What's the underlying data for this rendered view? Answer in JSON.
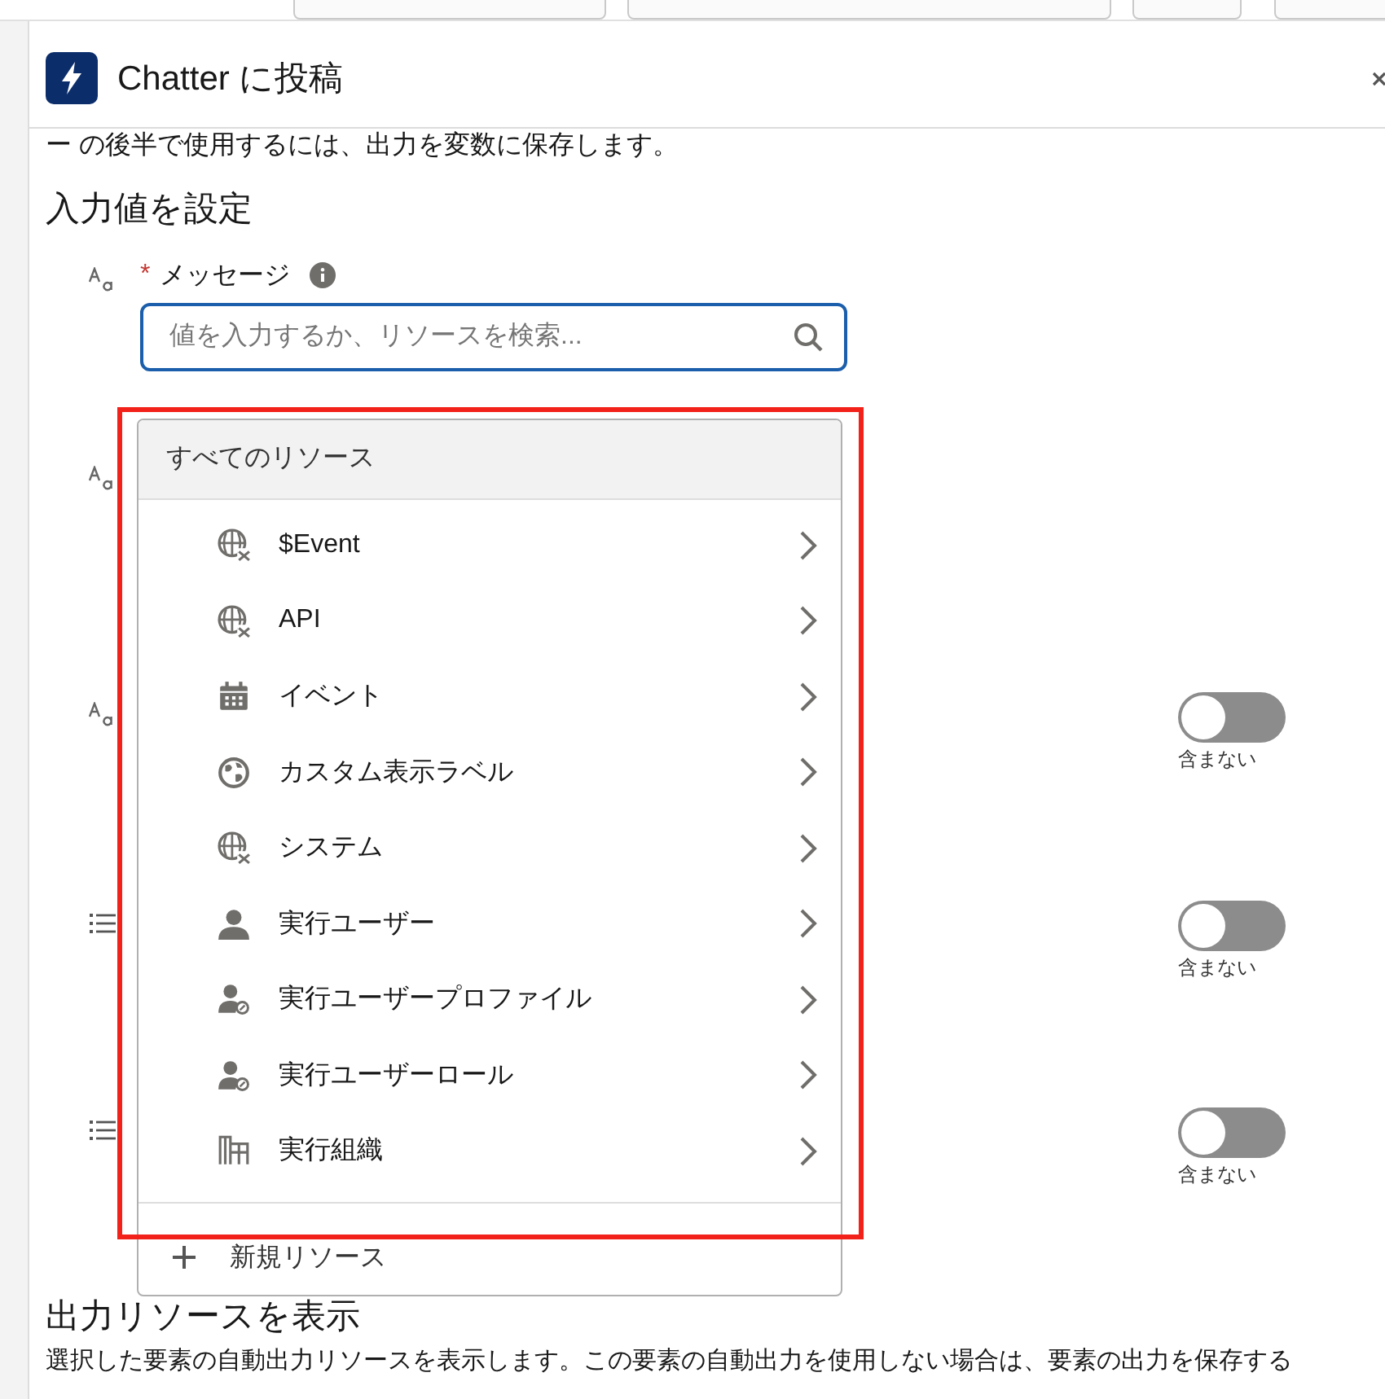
{
  "header": {
    "title": "Chatter に投稿"
  },
  "intro_text": "ー の後半で使用するには、出力を変数に保存します。",
  "input_section": {
    "title": "入力値を設定"
  },
  "fields": [
    {
      "kind": "text",
      "label": "メッセージ",
      "required_mark": "*",
      "placeholder": "値を入力するか、リソースを検索..."
    },
    {
      "kind": "text"
    },
    {
      "kind": "text",
      "toggle": {
        "on": false,
        "label": "含まない"
      }
    },
    {
      "kind": "list",
      "toggle": {
        "on": false,
        "label": "含まない"
      }
    },
    {
      "kind": "list",
      "toggle": {
        "on": false,
        "label": "含まない"
      }
    }
  ],
  "dropdown": {
    "header": "すべてのリソース",
    "items": [
      {
        "kind": "global",
        "label": "$Event"
      },
      {
        "kind": "global",
        "label": "API"
      },
      {
        "kind": "event",
        "label": "イベント"
      },
      {
        "kind": "label",
        "label": "カスタム表示ラベル"
      },
      {
        "kind": "global",
        "label": "システム"
      },
      {
        "kind": "user",
        "label": "実行ユーザー"
      },
      {
        "kind": "role",
        "label": "実行ユーザープロファイル"
      },
      {
        "kind": "role",
        "label": "実行ユーザーロール"
      },
      {
        "kind": "org",
        "label": "実行組織"
      }
    ],
    "footer": "新規リソース",
    "highlighted": true
  },
  "output_section": {
    "title": "出力リソースを表示",
    "text": "選択した要素の自動出力リソースを表示します。この要素の自動出力を使用しない場合は、要素の出力を保存する"
  }
}
